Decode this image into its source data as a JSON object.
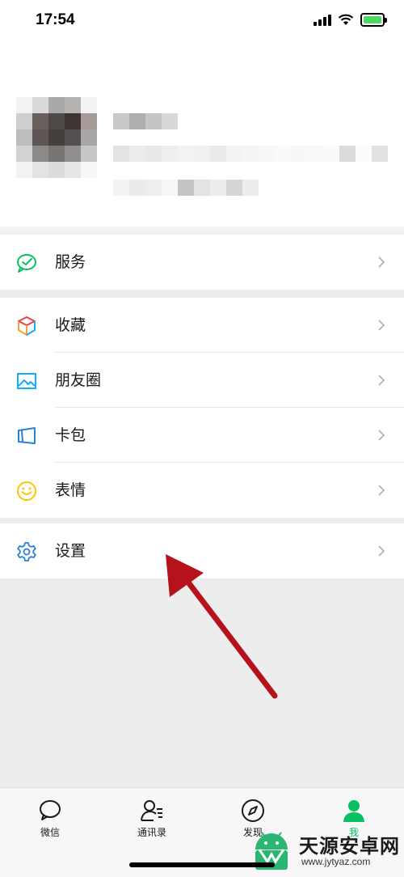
{
  "status_bar": {
    "time": "17:54"
  },
  "menu": {
    "services": {
      "label": "服务"
    },
    "favorites": {
      "label": "收藏"
    },
    "moments": {
      "label": "朋友圈"
    },
    "cards": {
      "label": "卡包"
    },
    "stickers": {
      "label": "表情"
    },
    "settings": {
      "label": "设置"
    }
  },
  "tabbar": {
    "tabs": [
      {
        "label": "微信"
      },
      {
        "label": "通讯录"
      },
      {
        "label": "发现"
      },
      {
        "label": "我"
      }
    ]
  },
  "colors": {
    "accent": "#07c160",
    "annotation_arrow": "#b5121b",
    "background": "#ededed"
  },
  "watermark": {
    "name": "天源安卓网",
    "url": "www.jytyaz.com"
  }
}
